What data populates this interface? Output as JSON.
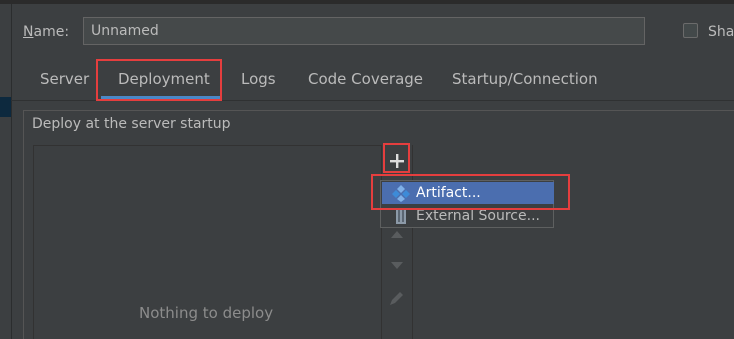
{
  "name_field": {
    "label_mnemonic": "N",
    "label_rest": "ame:",
    "value": "Unnamed"
  },
  "share_checkbox": {
    "label": "Sha",
    "checked": false
  },
  "tabs": [
    {
      "label": "Server",
      "selected": false
    },
    {
      "label": "Deployment",
      "selected": true
    },
    {
      "label": "Logs",
      "selected": false
    },
    {
      "label": "Code Coverage",
      "selected": false
    },
    {
      "label": "Startup/Connection",
      "selected": false
    }
  ],
  "deployment": {
    "section_title": "Deploy at the server startup",
    "empty_text": "Nothing to deploy",
    "toolbar": [
      {
        "icon": "plus-icon",
        "enabled": true
      },
      {
        "icon": "arrow-up-icon",
        "enabled": false
      },
      {
        "icon": "arrow-down-icon",
        "enabled": false
      },
      {
        "icon": "pencil-icon",
        "enabled": false
      }
    ]
  },
  "add_menu": {
    "items": [
      {
        "label": "Artifact...",
        "icon": "artifact-icon",
        "selected": true
      },
      {
        "label": "External Source...",
        "icon": "external-source-icon",
        "selected": false
      }
    ]
  },
  "colors": {
    "background": "#3c3f41",
    "selection": "#4b6eaf",
    "tab_underline": "#4a88c7",
    "highlight": "#e53e3e",
    "artifact_icon": "#3d8bd8"
  }
}
